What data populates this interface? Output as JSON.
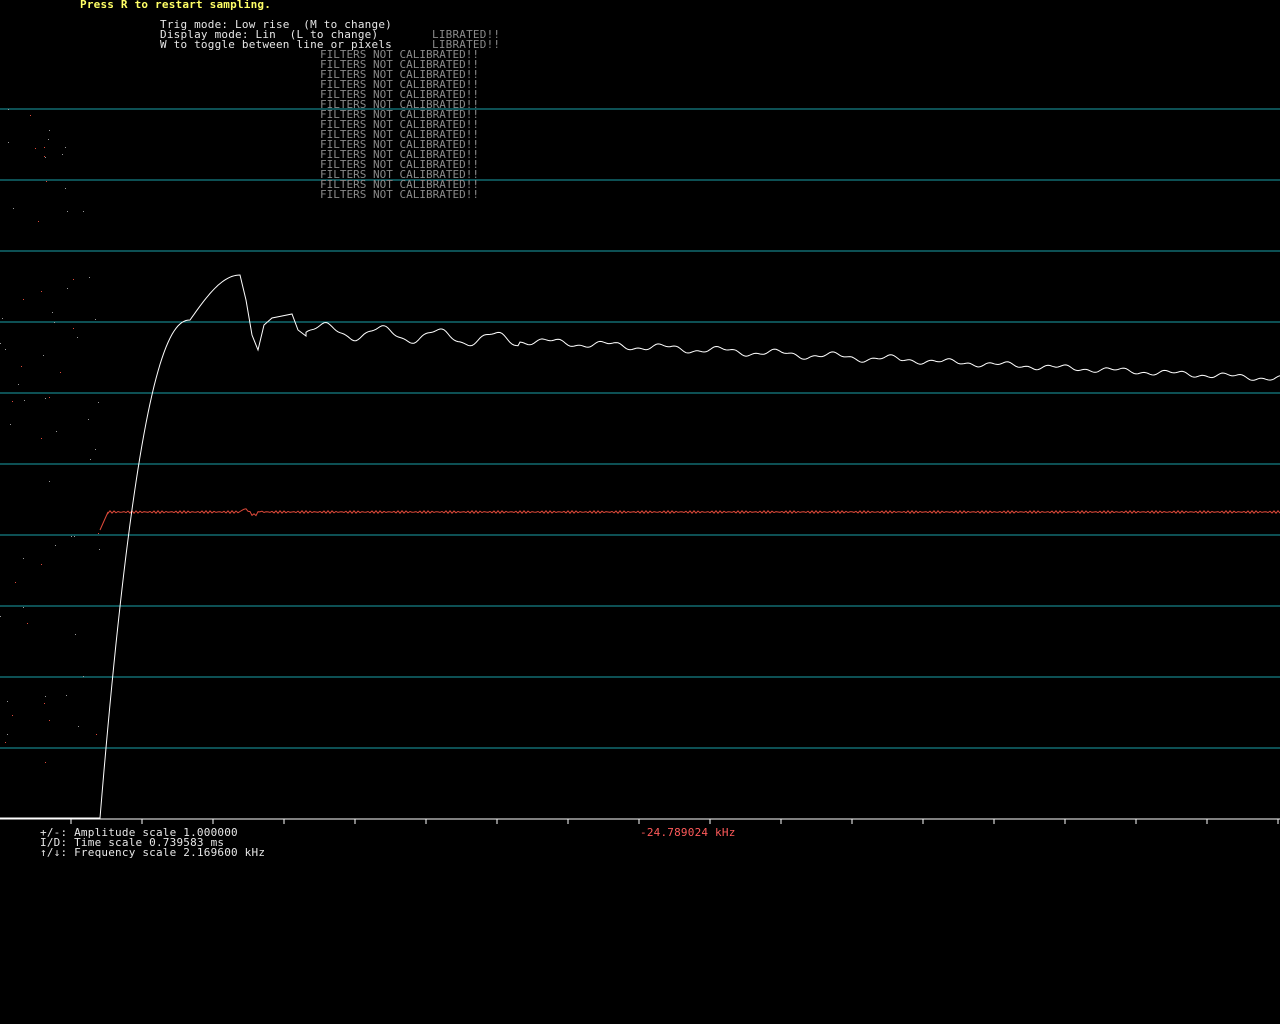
{
  "header": {
    "restart_hint": "Press R to restart sampling.",
    "trig_mode": "Trig mode: Low rise  (M to change)",
    "display_mode": "Display mode: Lin  (L to change)",
    "toggle_hint": "W to toggle between line or pixels"
  },
  "warning": {
    "text": "FILTERS NOT CALIBRATED!!",
    "partial_text": "LIBRATED!!"
  },
  "footer": {
    "amplitude": "+/-: Amplitude scale 1.000000",
    "time": "I/D: Time scale 0.739583 ms",
    "frequency": "↑/↓: Frequency scale 2.169600 kHz",
    "readout": "-24.789024 kHz"
  },
  "colors": {
    "background": "#000000",
    "gridline": "#1aa0a8",
    "signal": "#ffffff",
    "spectrum": "#e04a3a",
    "header_text": "#ffff66",
    "readout": "#ff5a5a"
  }
}
